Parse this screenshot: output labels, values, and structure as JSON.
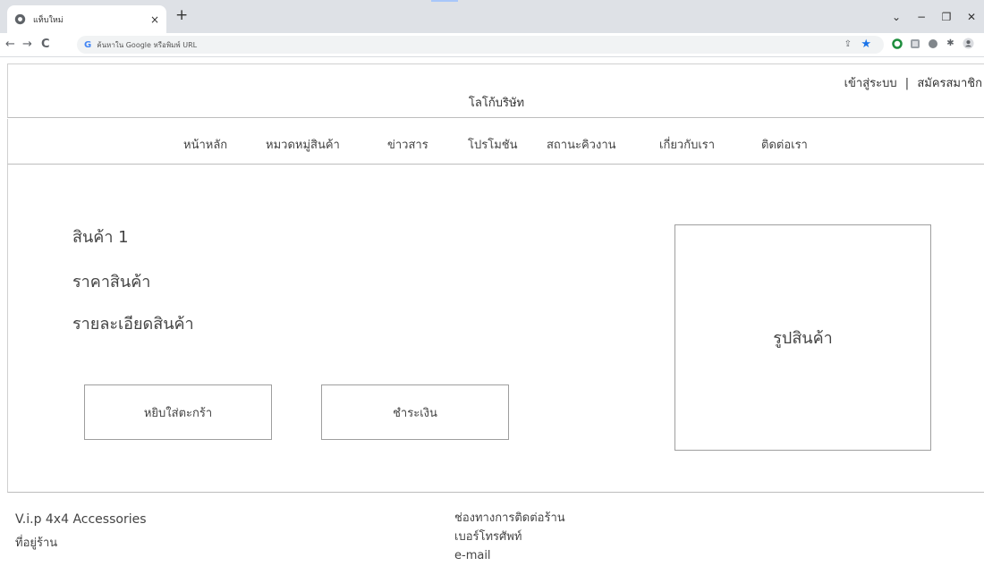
{
  "browser": {
    "tab": {
      "title": "แท็บใหม่",
      "close": "×",
      "favicon": "chrome-icon"
    },
    "new_tab": "+",
    "window_controls": {
      "dropdown": "⌄",
      "minimize": "−",
      "maximize": "❐",
      "close": "✕"
    },
    "nav": {
      "back": "←",
      "forward": "→",
      "reload": "C"
    },
    "omnibox": {
      "logo": "G",
      "placeholder": "ค้นหาใน Google หรือพิมพ์ URL"
    },
    "extensions": [
      "share-icon",
      "star-icon",
      "extension-green-icon",
      "extension-pdf-icon",
      "extension-circle-icon",
      "puzzle-icon",
      "profile-icon",
      "menu-icon"
    ],
    "accent_color": "#1a73e8"
  },
  "header": {
    "logo_text": "โลโก้บริษัท",
    "login": "เข้าสู่ระบบ",
    "separator": "|",
    "register": "สมัครสมาชิก"
  },
  "nav": {
    "items": [
      "หน้าหลัก",
      "หมวดหมู่สินค้า",
      "ข่าวสาร",
      "โปรโมชัน",
      "สถานะคิวงาน",
      "เกี่ยวกับเรา",
      "ติดต่อเรา"
    ]
  },
  "product": {
    "name": "สินค้า 1",
    "price": "ราคาสินค้า",
    "detail": "รายละเอียดสินค้า",
    "add_to_cart": "หยิบใส่ตะกร้า",
    "pay": "ชำระเงิน",
    "image_label": "รูปสินค้า"
  },
  "footer": {
    "shop_name": "V.i.p 4x4 Accessories",
    "address": "ที่อยู่ร้าน",
    "contact_title": "ช่องทางการติดต่อร้าน",
    "phone": "เบอร์โทรศัพท์",
    "email": "e-mail"
  }
}
